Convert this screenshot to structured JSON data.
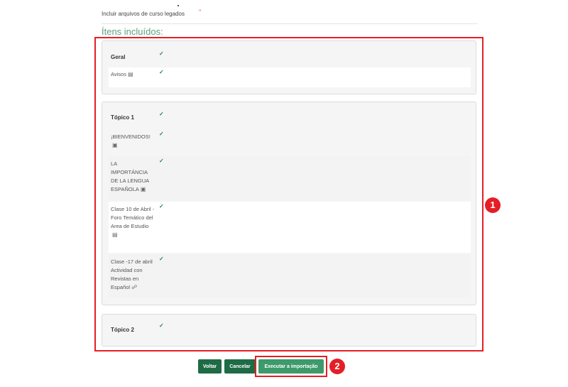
{
  "legacy": {
    "label": "Incluir arquivos de curso legados",
    "value": "ʺ"
  },
  "included_heading": "Ítens incluídos:",
  "check_mark": "✓",
  "cards": [
    {
      "rows": [
        {
          "label": "Geral",
          "icon": ""
        },
        {
          "label": "Avisos",
          "icon": "forum-icon"
        }
      ]
    },
    {
      "rows": [
        {
          "label": "Tópico 1",
          "icon": ""
        },
        {
          "label": "¡BIENVENIDOS!",
          "icon": "image-icon"
        },
        {
          "label": "LA IMPORTÁNCIA DE LA LENGUA ESPAÑOLA",
          "icon": "image-icon"
        },
        {
          "label": "Clase 10 de Abril - Foro Temático del Area de Estudio",
          "icon": "forum-icon"
        },
        {
          "label": "Clase -17 de abril Actividad con Revistas en Español",
          "icon": "link-icon"
        }
      ]
    },
    {
      "rows": [
        {
          "label": "Tópico 2",
          "icon": ""
        }
      ]
    }
  ],
  "buttons": {
    "back": "Voltar",
    "cancel": "Cancelar",
    "execute": "Executar a importação"
  },
  "annotations": {
    "badge1": "1",
    "badge2": "2"
  },
  "colors": {
    "highlight": "#e41e26",
    "primary": "#1e6b46",
    "accent": "#3d9a6b",
    "heading": "#5fa07e"
  }
}
